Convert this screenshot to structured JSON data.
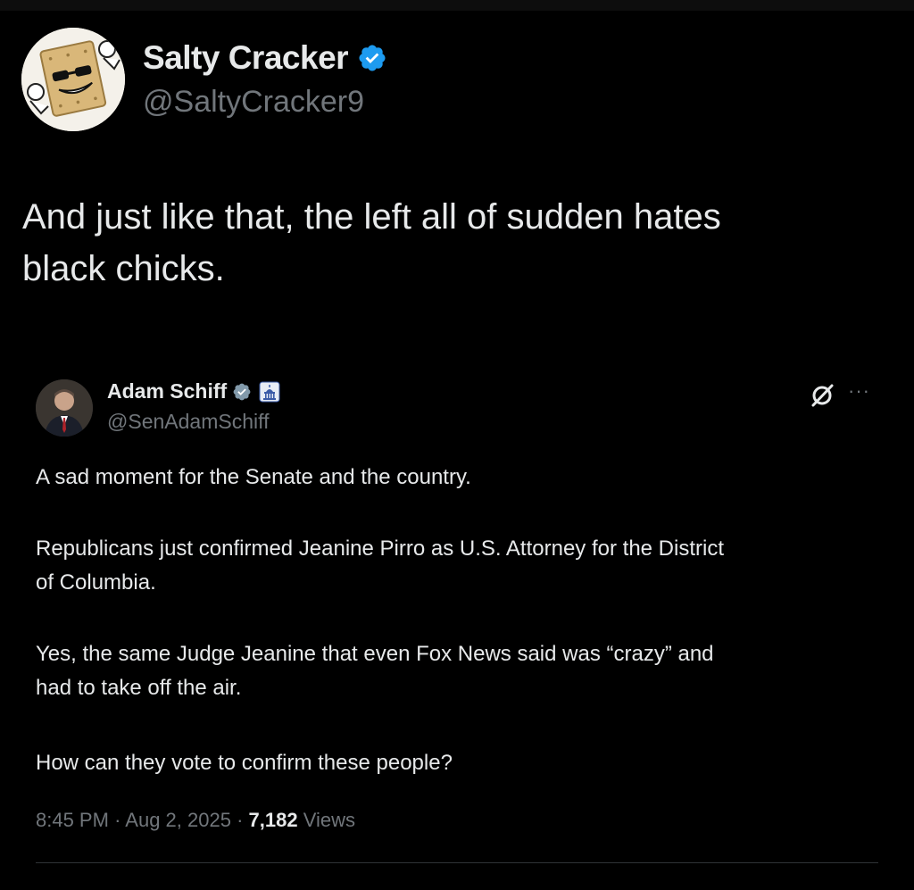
{
  "main_tweet": {
    "author_name": "Salty Cracker",
    "author_handle": "@SaltyCracker9",
    "text_lines": [
      "And just like that, the left all of sudden hates",
      "black chicks."
    ]
  },
  "quoted_tweet": {
    "author_name": "Adam Schiff",
    "author_handle": "@SenAdamSchiff",
    "paragraphs": [
      [
        "A sad moment for the Senate and the country."
      ],
      [
        "Republicans just confirmed Jeanine Pirro as U.S. Attorney for the District",
        "of Columbia."
      ],
      [
        "Yes, the same Judge Jeanine that even Fox News said was “crazy” and",
        "had to take off the air."
      ],
      [
        "How can they vote to confirm these people?"
      ]
    ],
    "time": "8:45 PM",
    "separator": "·",
    "date": "Aug 2, 2025",
    "views_count": "7,182",
    "views_label": "Views",
    "more_label": "···"
  },
  "colors": {
    "background": "#000000",
    "text": "#e7e9ea",
    "muted": "#71767b",
    "verified_blue": "#1d9bf0",
    "divider": "#2f3336"
  },
  "icons": {
    "verified": "verified-badge-icon",
    "gov_badge": "gray-verified-badge-icon",
    "affiliation": "capitol-affiliation-icon",
    "grok": "grok-icon",
    "more": "more-options-icon"
  }
}
